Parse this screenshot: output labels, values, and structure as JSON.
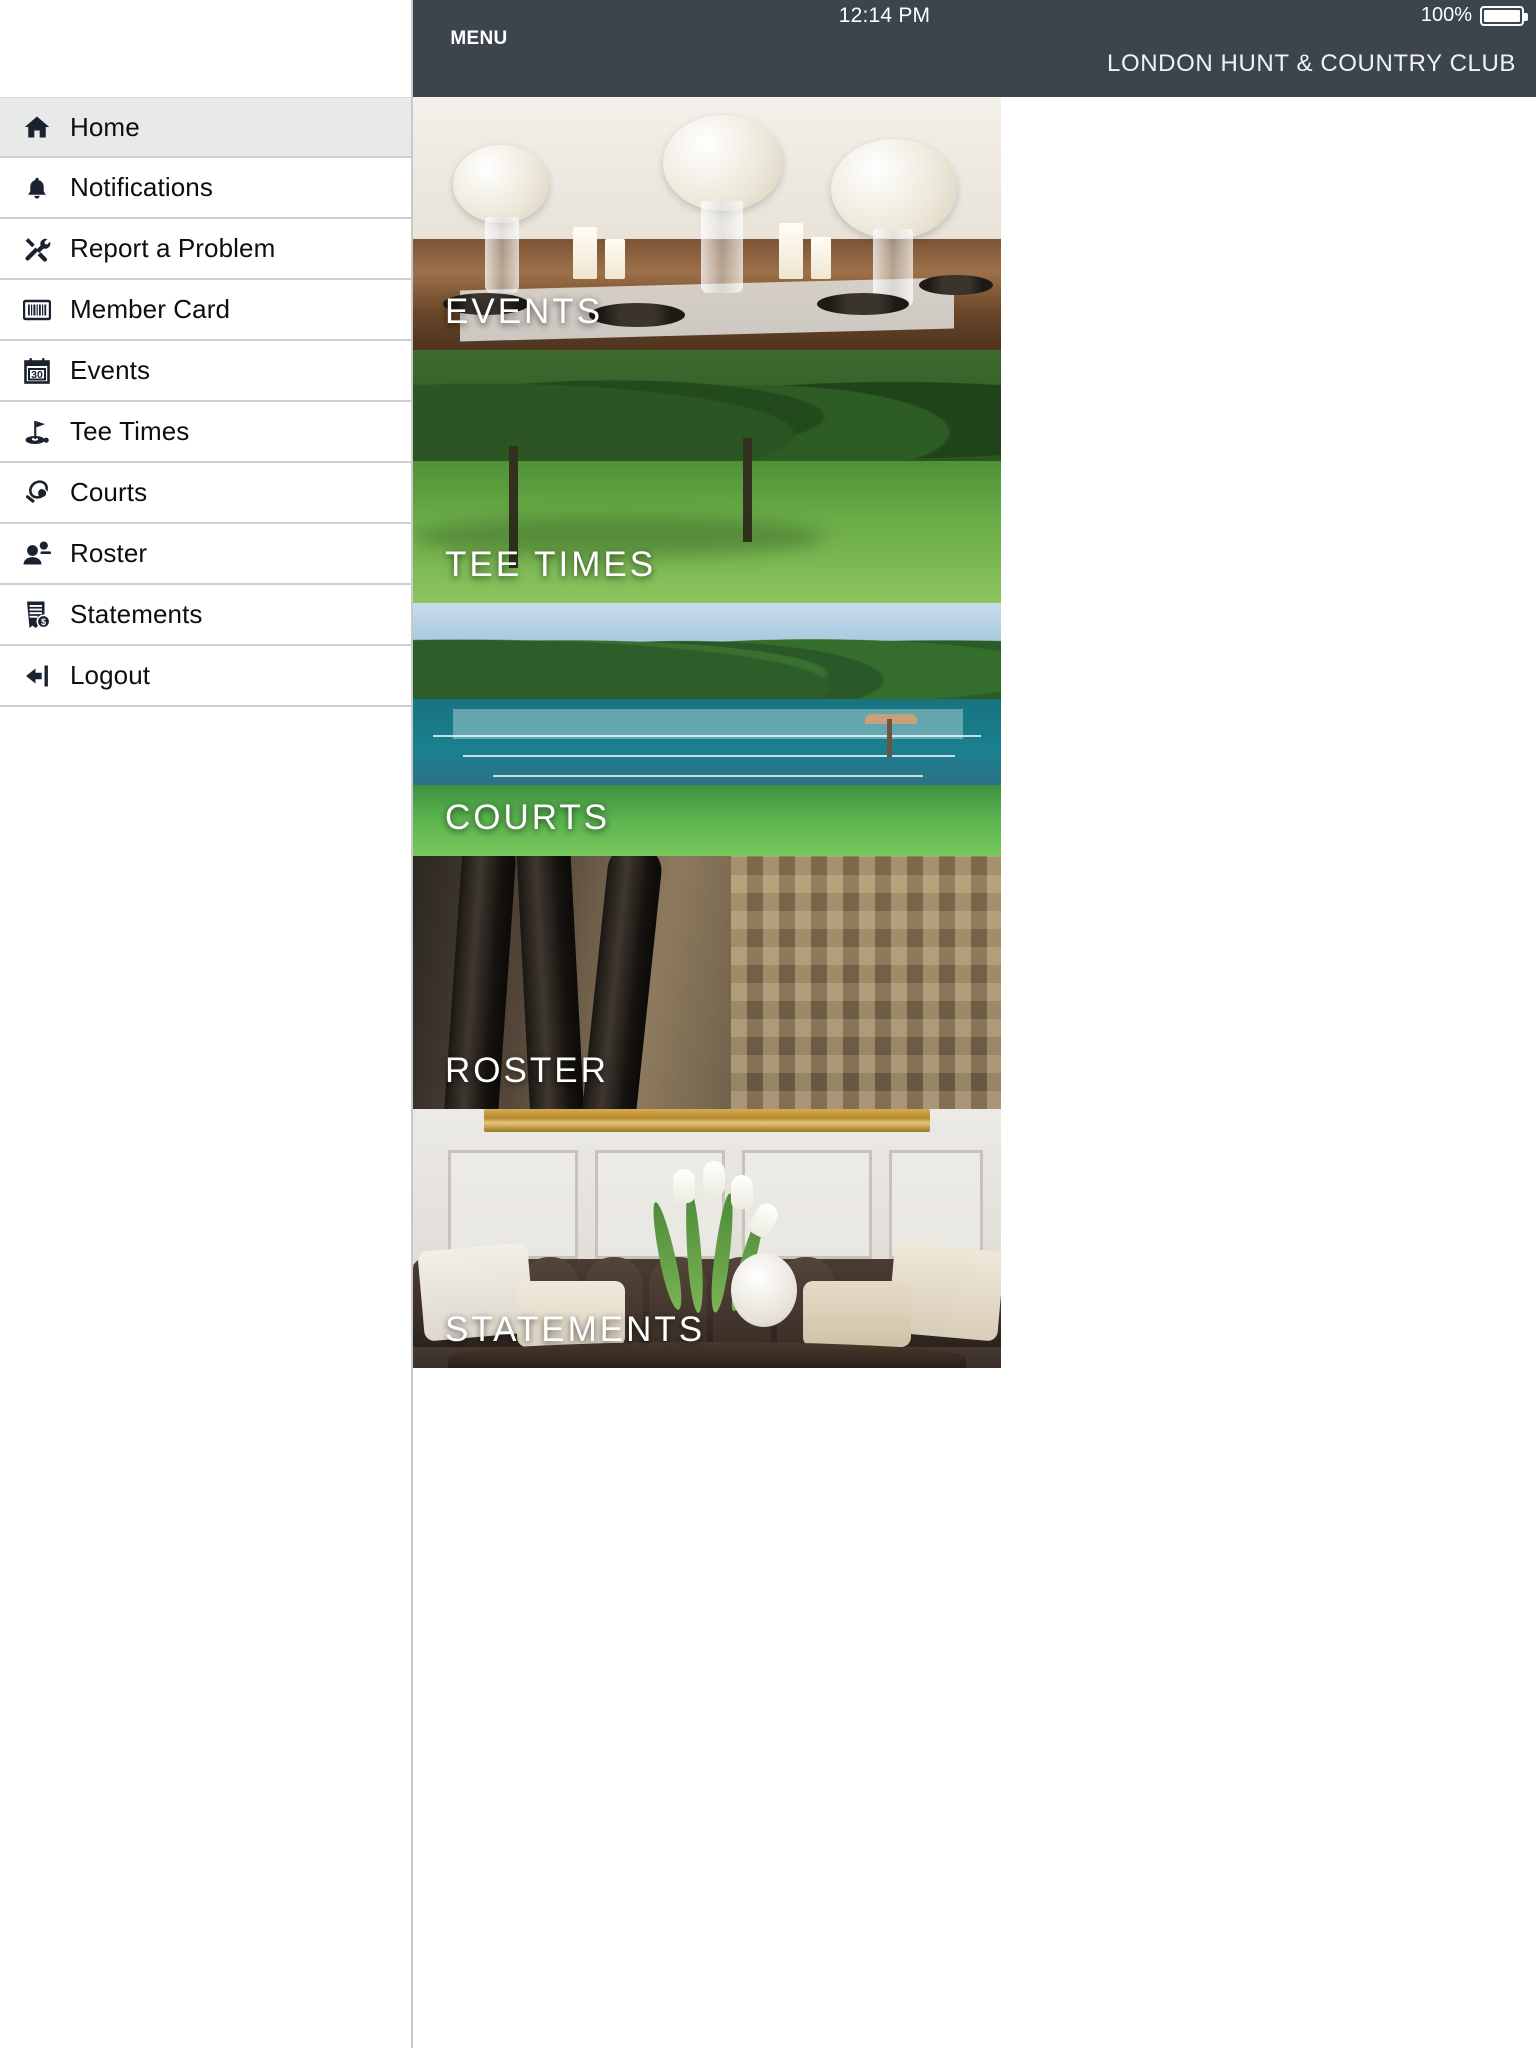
{
  "statusbar": {
    "time": "12:14 PM",
    "battery_percent": "100%",
    "battery_icon": "battery-full-icon"
  },
  "appbar": {
    "menu_button_label": "MENU",
    "menu_icon": "hamburger-icon",
    "club_title": "LONDON HUNT & COUNTRY CLUB"
  },
  "sidebar": {
    "items": [
      {
        "label": "Home",
        "icon": "home-icon",
        "active": true
      },
      {
        "label": "Notifications",
        "icon": "bell-icon",
        "active": false
      },
      {
        "label": "Report a Problem",
        "icon": "tools-icon",
        "active": false
      },
      {
        "label": "Member Card",
        "icon": "barcode-icon",
        "active": false
      },
      {
        "label": "Events",
        "icon": "calendar-icon",
        "active": false
      },
      {
        "label": "Tee Times",
        "icon": "golf-flag-icon",
        "active": false
      },
      {
        "label": "Courts",
        "icon": "tennis-racquet-icon",
        "active": false
      },
      {
        "label": "Roster",
        "icon": "person-add-icon",
        "active": false
      },
      {
        "label": "Statements",
        "icon": "invoice-icon",
        "active": false
      },
      {
        "label": "Logout",
        "icon": "logout-icon",
        "active": false
      }
    ]
  },
  "tiles": [
    {
      "label": "EVENTS",
      "image": "banquet-table-photo"
    },
    {
      "label": "TEE TIMES",
      "image": "golf-course-photo"
    },
    {
      "label": "COURTS",
      "image": "tennis-courts-photo"
    },
    {
      "label": "ROSTER",
      "image": "golf-club-grips-photo"
    },
    {
      "label": "STATEMENTS",
      "image": "lounge-sofa-photo"
    }
  ],
  "colors": {
    "appbar_bg": "#3c444d",
    "sidebar_bg": "#ffffff",
    "sidebar_active_bg": "#e8eaea",
    "divider": "#cfcfcf",
    "label_text": "#ffffff"
  }
}
